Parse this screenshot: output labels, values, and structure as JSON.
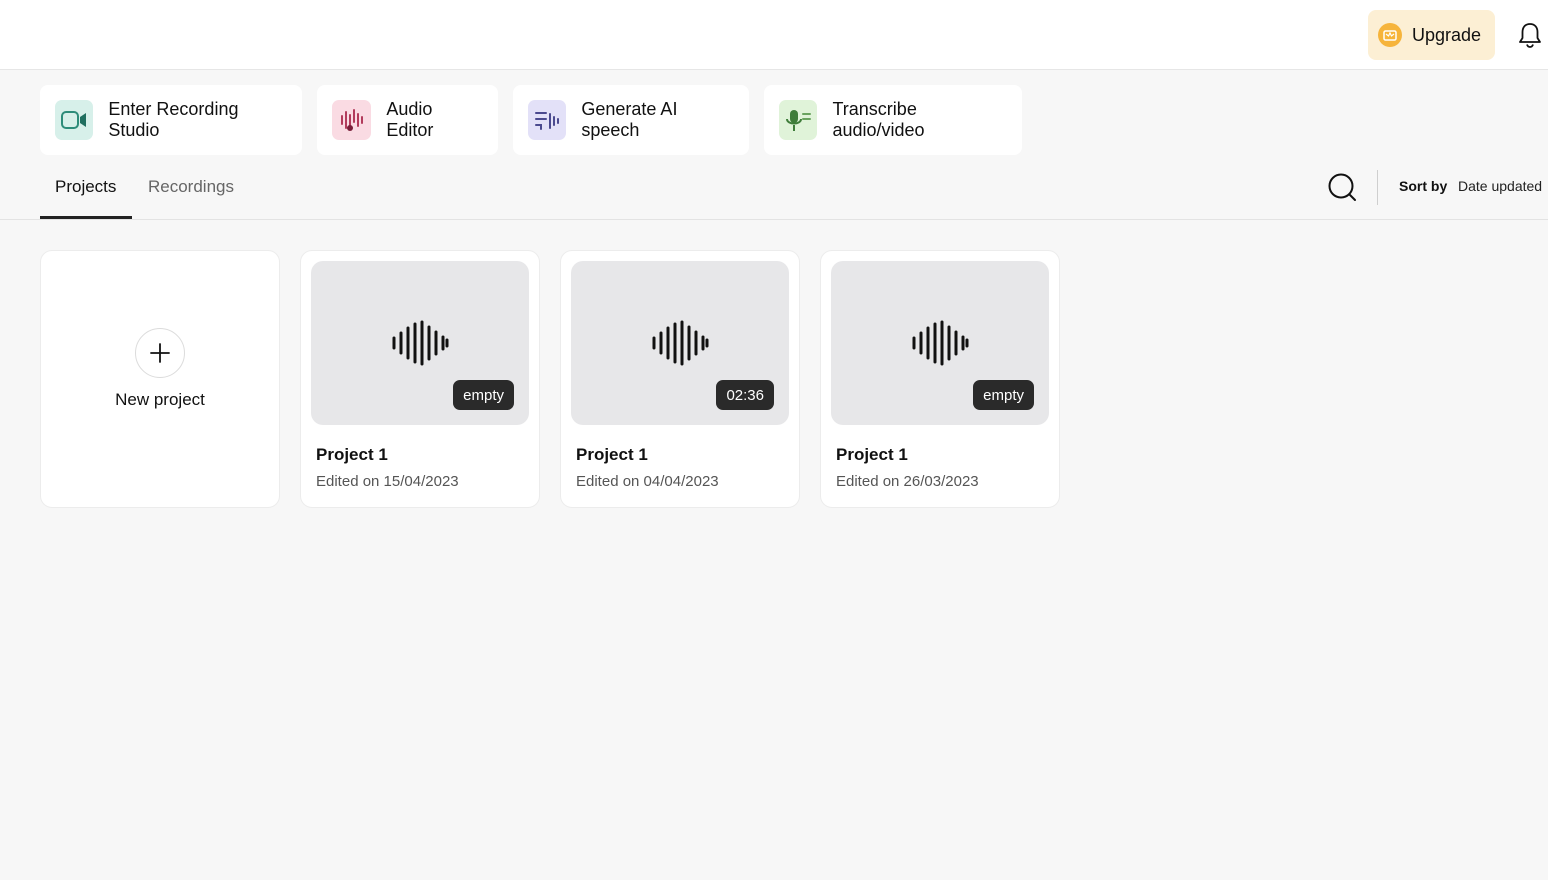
{
  "header": {
    "upgrade_label": "Upgrade"
  },
  "actions": [
    {
      "label": "Enter Recording Studio",
      "icon": "video-camera-icon",
      "color": "#d7f0ea"
    },
    {
      "label": "Audio Editor",
      "icon": "audio-waveform-icon",
      "color": "#fadbe3"
    },
    {
      "label": "Generate AI speech",
      "icon": "ai-speech-icon",
      "color": "#e3e1f8"
    },
    {
      "label": "Transcribe audio/video",
      "icon": "microphone-transcribe-icon",
      "color": "#e0f3d9"
    }
  ],
  "tabs": [
    {
      "label": "Projects",
      "active": true
    },
    {
      "label": "Recordings",
      "active": false
    }
  ],
  "sort": {
    "label": "Sort by",
    "value": "Date updated"
  },
  "new_project": {
    "label": "New project"
  },
  "projects": [
    {
      "title": "Project 1",
      "edited": "Edited on 15/04/2023",
      "badge": "empty"
    },
    {
      "title": "Project 1",
      "edited": "Edited on 04/04/2023",
      "badge": "02:36"
    },
    {
      "title": "Project 1",
      "edited": "Edited on 26/03/2023",
      "badge": "empty"
    }
  ]
}
